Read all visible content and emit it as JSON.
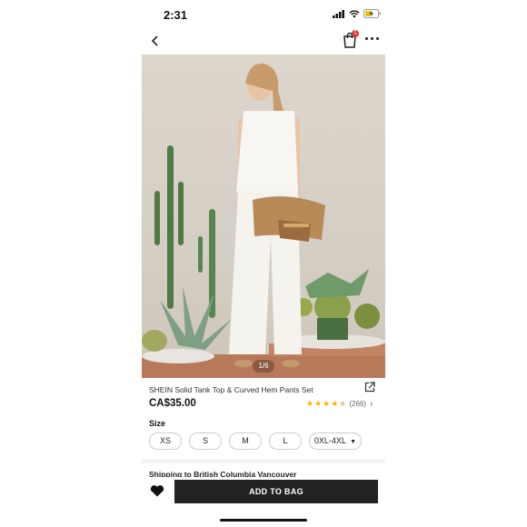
{
  "status_bar": {
    "time": "2:31"
  },
  "nav": {
    "cart_badge": "1"
  },
  "image": {
    "counter": "1/6"
  },
  "product": {
    "title": "SHEIN Solid Tank Top & Curved Hem Pants Set",
    "price": "CA$35.00",
    "rating": 4.5,
    "review_count": "(266)",
    "size_label": "Size",
    "sizes": [
      "XS",
      "S",
      "M",
      "L",
      "0XL-4XL"
    ],
    "shipping_text": "Shipping to British Columbia Vancouver"
  },
  "actions": {
    "add_to_bag": "ADD TO BAG"
  },
  "colors": {
    "accent": "#222222",
    "badge": "#e0373a",
    "star": "#f5b400"
  }
}
